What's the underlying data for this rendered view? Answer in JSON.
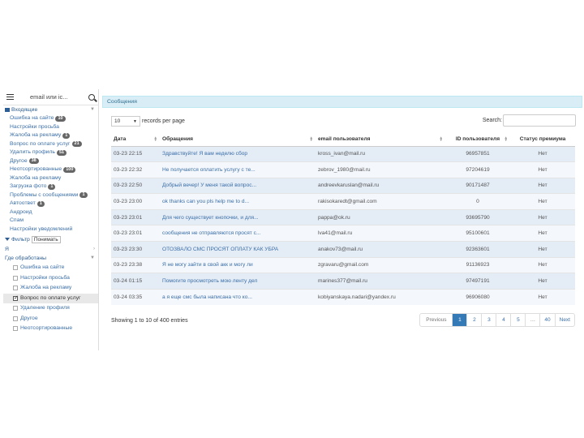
{
  "sidebar": {
    "search_text": "email или ic...",
    "group_incoming": "Входящие",
    "items": [
      {
        "label": "Ошибка на сайте",
        "badge": "10"
      },
      {
        "label": "Настройки просьба",
        "badge": ""
      },
      {
        "label": "Жалоба на рекламу",
        "badge": "1"
      },
      {
        "label": "Вопрос по оплате услуг",
        "badge": "21"
      },
      {
        "label": "Удалить профиль",
        "badge": "51"
      },
      {
        "label": "Другое",
        "badge": "38"
      },
      {
        "label": "Неотсортированные",
        "badge": "100"
      },
      {
        "label": "Жалоба на рекламу",
        "badge": ""
      },
      {
        "label": "Загрузка фото",
        "badge": "1"
      },
      {
        "label": "Проблемы с сообщениями",
        "badge": "1"
      },
      {
        "label": "Автоответ",
        "badge": "1"
      },
      {
        "label": "Андроид",
        "badge": ""
      },
      {
        "label": "Спам",
        "badge": ""
      },
      {
        "label": "Настройки уведомлений",
        "badge": ""
      }
    ],
    "filter_label": "Фильтр",
    "filter_value": "Понимать",
    "group_me": "Я",
    "group_processed": "Где обработаны",
    "sub_items": [
      {
        "label": "Ошибка на сайте",
        "checked": false,
        "active": false
      },
      {
        "label": "Настройки просьба",
        "checked": false,
        "active": false
      },
      {
        "label": "Жалоба на рекламу",
        "checked": false,
        "active": false
      },
      {
        "label": "Вопрос по оплате услуг",
        "checked": true,
        "active": true
      },
      {
        "label": "Удаление профиля",
        "checked": false,
        "active": false
      },
      {
        "label": "Другое",
        "checked": false,
        "active": false
      },
      {
        "label": "Неотсортированные",
        "checked": false,
        "active": false
      }
    ]
  },
  "main": {
    "panel_title": "Сообщения",
    "length_value": "10",
    "length_label": "records per page",
    "search_label": "Search:",
    "search_value": "",
    "columns": [
      "Дата",
      "Обращения",
      "email пользователя",
      "ID пользователя",
      "Статус премиума"
    ],
    "rows": [
      {
        "date": "03-23 22:15",
        "msg": "Здравствуйте! Я вам неделю сбор",
        "email": "kross_ivan@mail.ru",
        "id": "96957851",
        "status": "Нет"
      },
      {
        "date": "03-23 22:32",
        "msg": "Не получается оплатить услугу с те...",
        "email": "zebrov_1980@mail.ru",
        "id": "97204619",
        "status": "Нет"
      },
      {
        "date": "03-23 22:50",
        "msg": "Добрый вечер! У меня такой вопрос...",
        "email": "andreevkaruslan@mail.ru",
        "id": "90171487",
        "status": "Нет"
      },
      {
        "date": "03-23 23:00",
        "msg": "ok thanks can you pls help me to d...",
        "email": "rakisokaredt@gmail.com",
        "id": "0",
        "status": "Нет"
      },
      {
        "date": "03-23 23:01",
        "msg": "Для чего существует кнопочки, и для...",
        "email": "pappa@ok.ru",
        "id": "93695790",
        "status": "Нет"
      },
      {
        "date": "03-23 23:01",
        "msg": "сообщения не отправляются просят с...",
        "email": "lva41@mail.ru",
        "id": "95100601",
        "status": "Нет"
      },
      {
        "date": "03-23 23:30",
        "msg": "ОТОЗВАЛО СМС ПРОСЯТ ОПЛАТУ КАК УБРА",
        "email": "anakov73@mail.ru",
        "id": "92363601",
        "status": "Нет"
      },
      {
        "date": "03-23 23:38",
        "msg": "Я не могу зайти в свой акк и могу ли",
        "email": "zgravaru@gmail.com",
        "id": "91136923",
        "status": "Нет"
      },
      {
        "date": "03-24 01:15",
        "msg": "Помогите просмотреть мою ленту дел",
        "email": "marines377@mail.ru",
        "id": "97497191",
        "status": "Нет"
      },
      {
        "date": "03-24 03:35",
        "msg": "а я еще смс была написана что ко...",
        "email": "kobiyanskaya.nadari@yandex.ru",
        "id": "96906080",
        "status": "Нет"
      }
    ],
    "info": "Showing 1 to 10 of 400 entries",
    "pagination": [
      "Previous",
      "1",
      "2",
      "3",
      "4",
      "5",
      "…",
      "40",
      "Next"
    ]
  }
}
